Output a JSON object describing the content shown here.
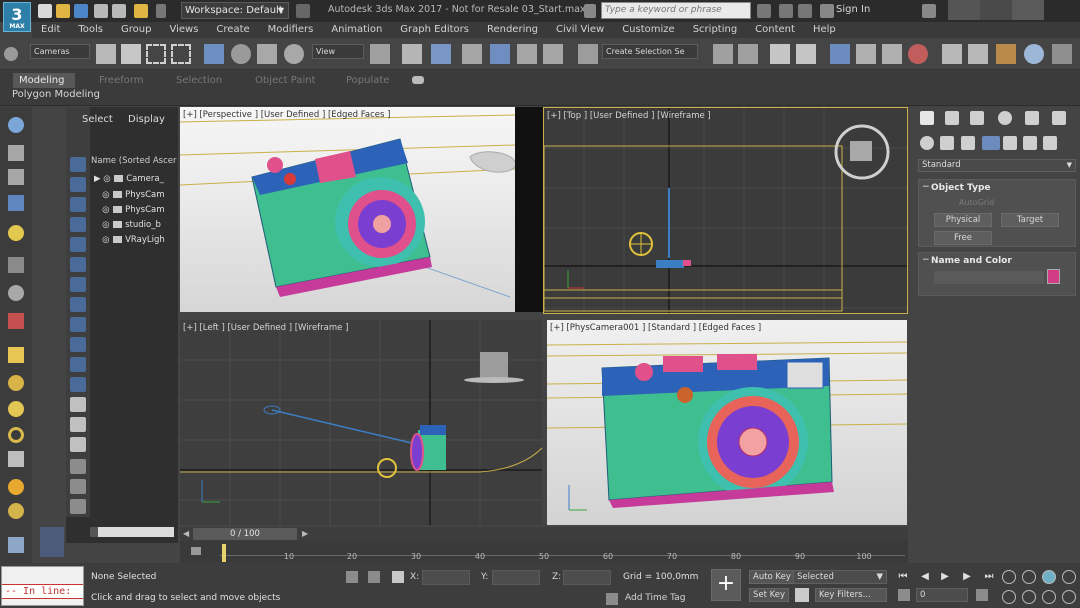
{
  "title_bar": {
    "logo_text": "3",
    "logo_sub": "MAX",
    "workspace": "Workspace: Default",
    "window_title": "Autodesk 3ds Max 2017 - Not for Resale   03_Start.max",
    "search_placeholder": "Type a keyword or phrase",
    "sign_in": "Sign In"
  },
  "menu": [
    "Edit",
    "Tools",
    "Group",
    "Views",
    "Create",
    "Modifiers",
    "Animation",
    "Graph Editors",
    "Rendering",
    "Civil View",
    "Customize",
    "Scripting",
    "Content",
    "Help"
  ],
  "toolbar": {
    "filter_dropdown": "Cameras",
    "ref_coord_dropdown": "View",
    "selection_set": "Create Selection Se"
  },
  "ribbon": {
    "tabs": [
      "Modeling",
      "Freeform",
      "Selection",
      "Object Paint",
      "Populate"
    ],
    "active_tab": "Modeling",
    "sub_label": "Polygon Modeling"
  },
  "scene_explorer": {
    "tabs": [
      "Select",
      "Display"
    ],
    "header": "Name (Sorted Ascer",
    "rows": [
      "Camera_",
      "PhysCam",
      "PhysCam",
      "studio_b",
      "VRayLigh"
    ]
  },
  "viewports": {
    "perspective": "[+] [Perspective ] [User Defined ] [Edged Faces ]",
    "top": "[+] [Top ] [User Defined ] [Wireframe ]",
    "left": "[+] [Left ] [User Defined ] [Wireframe ]",
    "camera": "[+] [PhysCamera001 ] [Standard ] [Edged Faces ]"
  },
  "command_panel": {
    "category_dropdown": "Standard",
    "object_type": {
      "title": "Object Type",
      "autogrid": "AutoGrid",
      "buttons": [
        "Physical",
        "Target",
        "Free"
      ]
    },
    "name_and_color": {
      "title": "Name and Color",
      "color": "#d23c86"
    }
  },
  "timeline": {
    "frame_display": "0 / 100",
    "ticks": [
      "10",
      "20",
      "30",
      "40",
      "50",
      "60",
      "70",
      "80",
      "90",
      "100"
    ]
  },
  "status_bar": {
    "maxscript_text": "-- In line:",
    "selection_status": "None Selected",
    "prompt": "Click and drag to select and move objects",
    "x_label": "X:",
    "y_label": "Y:",
    "z_label": "Z:",
    "grid": "Grid = 100,0mm",
    "add_time_tag": "Add Time Tag",
    "auto_key": "Auto Key",
    "set_key": "Set Key",
    "selected_dropdown": "Selected",
    "key_filters": "Key Filters...",
    "current_frame": "0"
  },
  "colors": {
    "accent_blue": "#2e7fa8",
    "viewport_active_border": "#c8b04a",
    "camera_green": "#3fbf8f",
    "camera_purple": "#7a3fd0",
    "camera_pink": "#e0508a"
  }
}
